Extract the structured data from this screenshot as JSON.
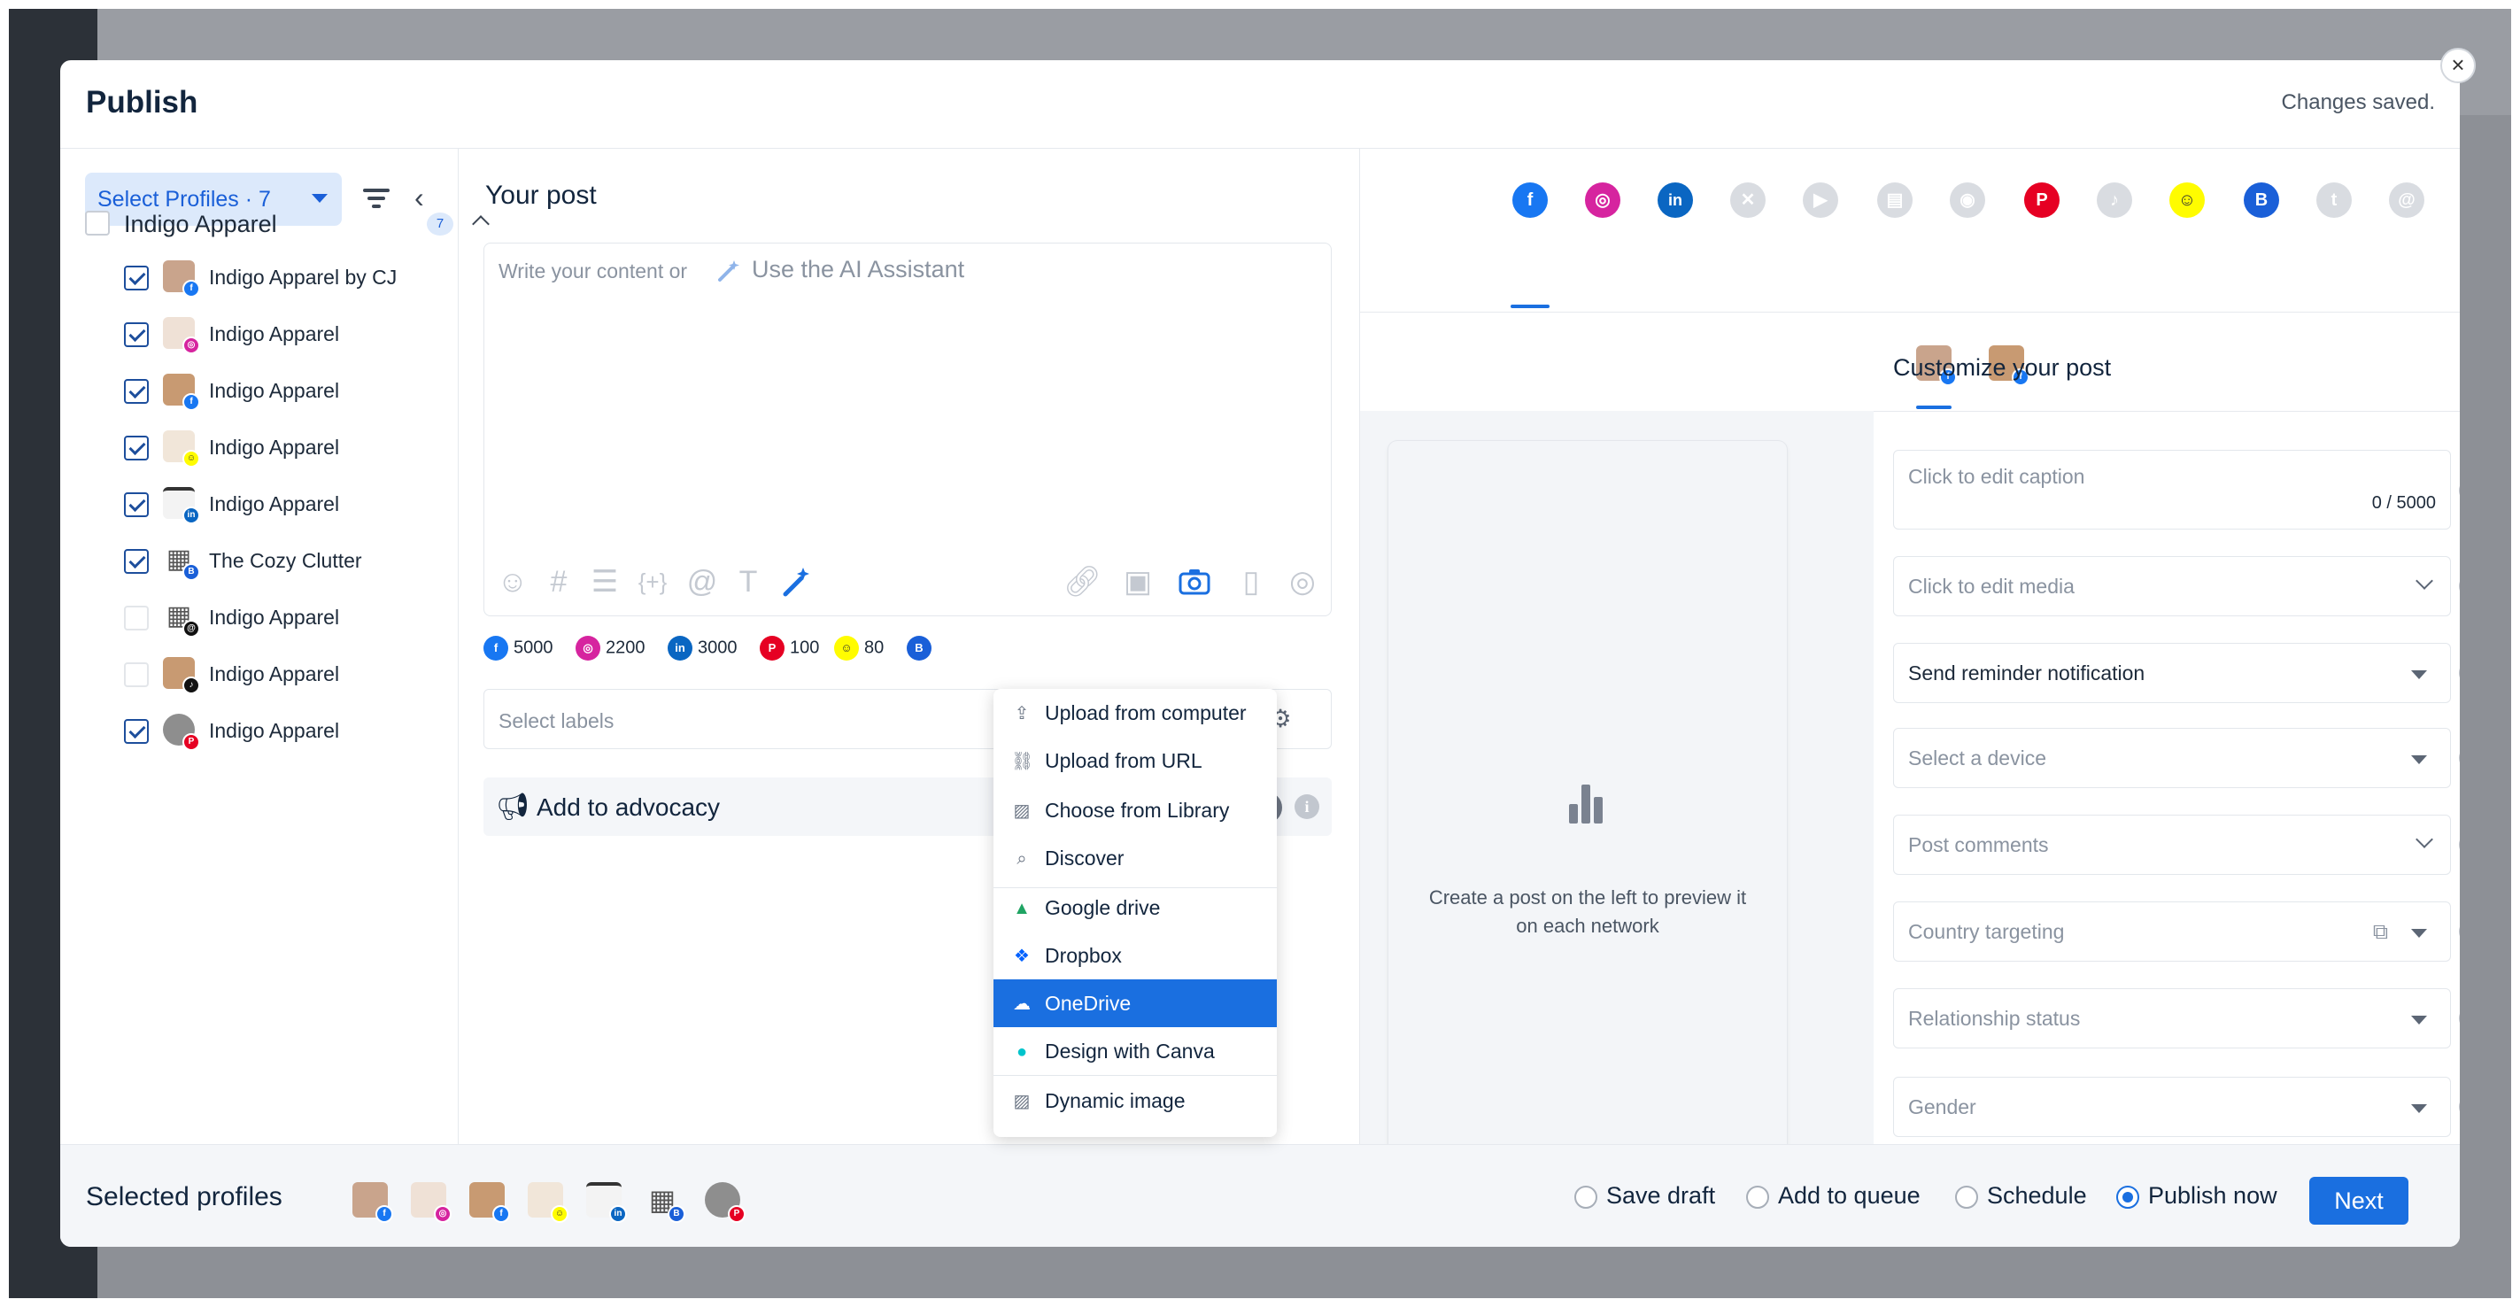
{
  "header": {
    "title": "Publish",
    "status": "Changes saved.",
    "close_icon": "×"
  },
  "left": {
    "select_profiles": "Select Profiles · 7",
    "group": {
      "label": "Indigo Apparel",
      "count": "7"
    },
    "profiles": [
      {
        "label": "Indigo Apparel by CJ",
        "checked": true,
        "network": "facebook"
      },
      {
        "label": "Indigo Apparel",
        "checked": true,
        "network": "instagram"
      },
      {
        "label": "Indigo Apparel",
        "checked": true,
        "network": "facebook"
      },
      {
        "label": "Indigo Apparel",
        "checked": true,
        "network": "snapchat"
      },
      {
        "label": "Indigo Apparel",
        "checked": true,
        "network": "linkedin"
      },
      {
        "label": "The Cozy Clutter",
        "checked": true,
        "network": "google-business"
      },
      {
        "label": "Indigo Apparel",
        "checked": false,
        "network": "threads"
      },
      {
        "label": "Indigo Apparel",
        "checked": false,
        "network": "tiktok"
      },
      {
        "label": "Indigo Apparel",
        "checked": true,
        "network": "pinterest"
      }
    ]
  },
  "editor": {
    "heading": "Your post",
    "placeholder": "Write your content or",
    "ai_assistant": "Use the AI Assistant",
    "char_limits": [
      {
        "network": "facebook",
        "limit": "5000"
      },
      {
        "network": "instagram",
        "limit": "2200"
      },
      {
        "network": "linkedin",
        "limit": "3000"
      },
      {
        "network": "pinterest",
        "limit": "100"
      },
      {
        "network": "snapchat",
        "limit": "80"
      }
    ],
    "labels_placeholder": "Select labels",
    "advocacy_label": "Add to advocacy"
  },
  "media_menu": {
    "items": [
      {
        "label": "Upload from computer",
        "icon": "upload-icon"
      },
      {
        "label": "Upload from URL",
        "icon": "link-icon"
      },
      {
        "label": "Choose from Library",
        "icon": "image-icon"
      },
      {
        "label": "Discover",
        "icon": "search-icon"
      },
      {
        "label": "Google drive",
        "icon": "google-drive-icon"
      },
      {
        "label": "Dropbox",
        "icon": "dropbox-icon"
      },
      {
        "label": "OneDrive",
        "icon": "onedrive-icon",
        "selected": true
      },
      {
        "label": "Design with Canva",
        "icon": "canva-icon"
      },
      {
        "label": "Dynamic image",
        "icon": "image-icon"
      }
    ]
  },
  "preview": {
    "empty_text": "Create a post on the left to preview it on each network"
  },
  "customize": {
    "title": "Customize your post",
    "caption_placeholder": "Click to edit caption",
    "caption_count": "0 / 5000",
    "media": "Click to edit media",
    "reminder": "Send reminder notification",
    "device": "Select a device",
    "comments": "Post comments",
    "country": "Country targeting",
    "relationship": "Relationship status",
    "gender": "Gender"
  },
  "footer": {
    "selected_profiles_label": "Selected profiles",
    "options": [
      {
        "label": "Save draft",
        "selected": false
      },
      {
        "label": "Add to queue",
        "selected": false
      },
      {
        "label": "Schedule",
        "selected": false
      },
      {
        "label": "Publish now",
        "selected": true
      }
    ],
    "next": "Next"
  },
  "colors": {
    "accent": "#1a6fe0",
    "facebook": "#1877f2",
    "instagram": "#d6249f",
    "linkedin": "#0a66c2",
    "pinterest": "#e60023",
    "snapchat": "#fffc00",
    "google_business": "#1a5fd8"
  }
}
